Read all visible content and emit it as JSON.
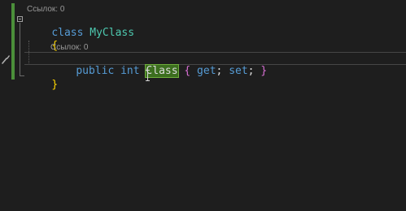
{
  "editor": {
    "class_codelens": "Ссылок: 0",
    "property_codelens": "Ссылок: 0",
    "line_class": {
      "keyword": "class",
      "name": "MyClass"
    },
    "line_open_brace": "{",
    "line_property": {
      "modifier": "public",
      "type": "int",
      "name": "Class",
      "open_brace": "{",
      "get": "get",
      "set": "set",
      "semicolon": ";",
      "close_brace": "}"
    },
    "line_close_brace": "}"
  },
  "colors": {
    "background": "#1e1e1e",
    "keyword": "#569cd6",
    "type_name": "#4ec9b0",
    "brace_level1": "#ffd700",
    "brace_level2": "#da70d6",
    "selection": "#3c6e1f",
    "change_bar": "#4b8f3a",
    "codelens": "#999999"
  },
  "icons": {
    "collapse": "collapse-icon",
    "quick_actions": "screwdriver-icon",
    "cursor": "text-cursor-icon"
  }
}
